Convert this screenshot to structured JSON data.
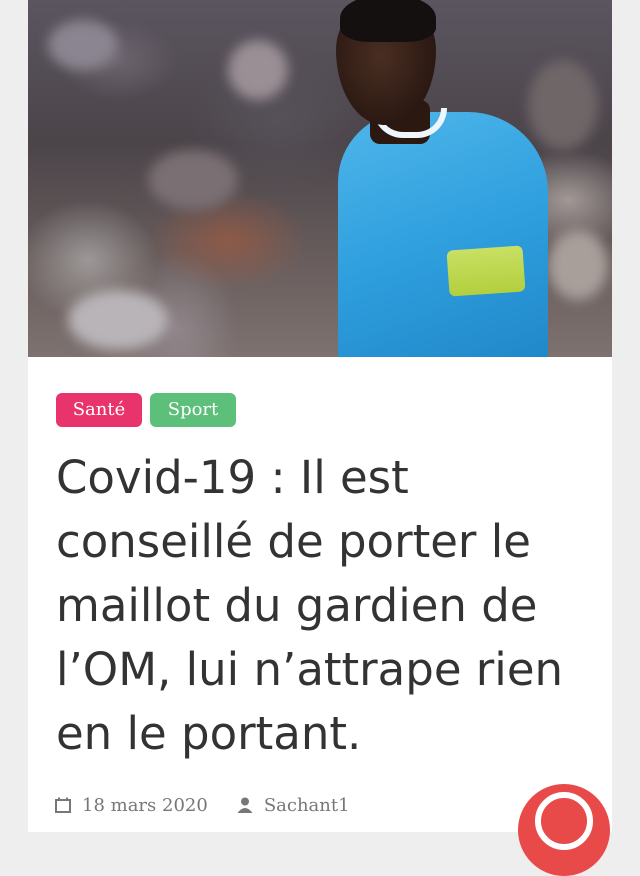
{
  "article": {
    "tags": [
      "Santé",
      "Sport"
    ],
    "headline": "Covid-19 : Il est conseillé de porter le maillot du gardien de l’OM, lui n’attrape rien en le portant.",
    "date": "18 mars 2020",
    "author": "Sachant1"
  },
  "colors": {
    "tag_sante": "#e8336c",
    "tag_sport": "#5cbf7a",
    "float_button": "#e84a4a"
  },
  "icons": {
    "date": "calendar-icon",
    "author": "user-icon"
  }
}
